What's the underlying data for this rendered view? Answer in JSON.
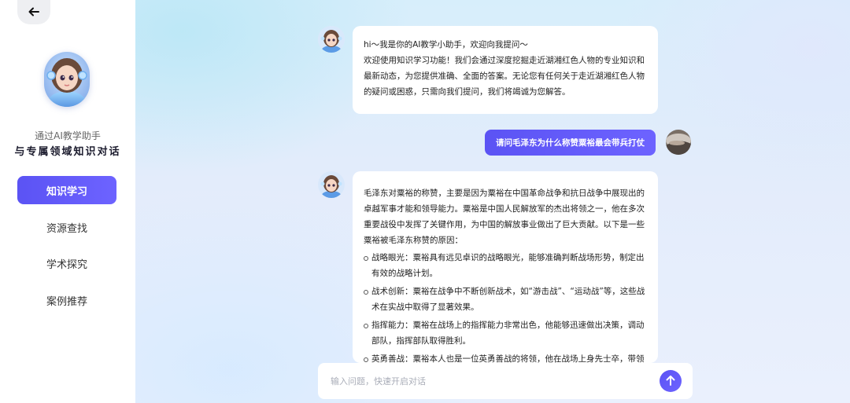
{
  "sidebar": {
    "back_icon": "arrow-left-icon",
    "subtitle": "通过AI教学助手",
    "title": "与专属领域知识对话",
    "nav": [
      {
        "label": "知识学习",
        "active": true
      },
      {
        "label": "资源查找",
        "active": false
      },
      {
        "label": "学术探究",
        "active": false
      },
      {
        "label": "案例推荐",
        "active": false
      }
    ]
  },
  "chat": {
    "greeting": {
      "line1": "hi～我是你的AI教学小助手，欢迎向我提问～",
      "body": "欢迎使用知识学习功能！我们会通过深度挖掘走近湖湘红色人物的专业知识和最新动态，为您提供准确、全面的答案。无论您有任何关于走近湖湘红色人物的疑问或困惑，只需向我们提问，我们将竭诚为您解答。"
    },
    "user_question": "请问毛泽东为什么称赞粟裕最会带兵打仗",
    "answer": {
      "intro": "毛泽东对粟裕的称赞，主要是因为粟裕在中国革命战争和抗日战争中展现出的卓越军事才能和领导能力。粟裕是中国人民解放军的杰出将领之一，他在多次重要战役中发挥了关键作用，为中国的解放事业做出了巨大贡献。以下是一些粟裕被毛泽东称赞的原因：",
      "points": [
        "战略眼光：粟裕具有远见卓识的战略眼光，能够准确判断战场形势，制定出有效的战略计划。",
        "战术创新：粟裕在战争中不断创新战术，如“游击战”、“运动战”等，这些战术在实战中取得了显著效果。",
        "指挥能力：粟裕在战场上的指挥能力非常出色，他能够迅速做出决策，调动部队，指挥部队取得胜利。",
        "英勇善战：粟裕本人也是一位英勇善战的将领，他在战场上身先士卒，带领"
      ]
    }
  },
  "input": {
    "placeholder": "输入问题，快速开启对话",
    "send_icon": "arrow-up-icon"
  },
  "colors": {
    "accent": "#5b53f4",
    "sidebar_bg": "#ffffff",
    "main_bg": "#e3ecfb"
  }
}
